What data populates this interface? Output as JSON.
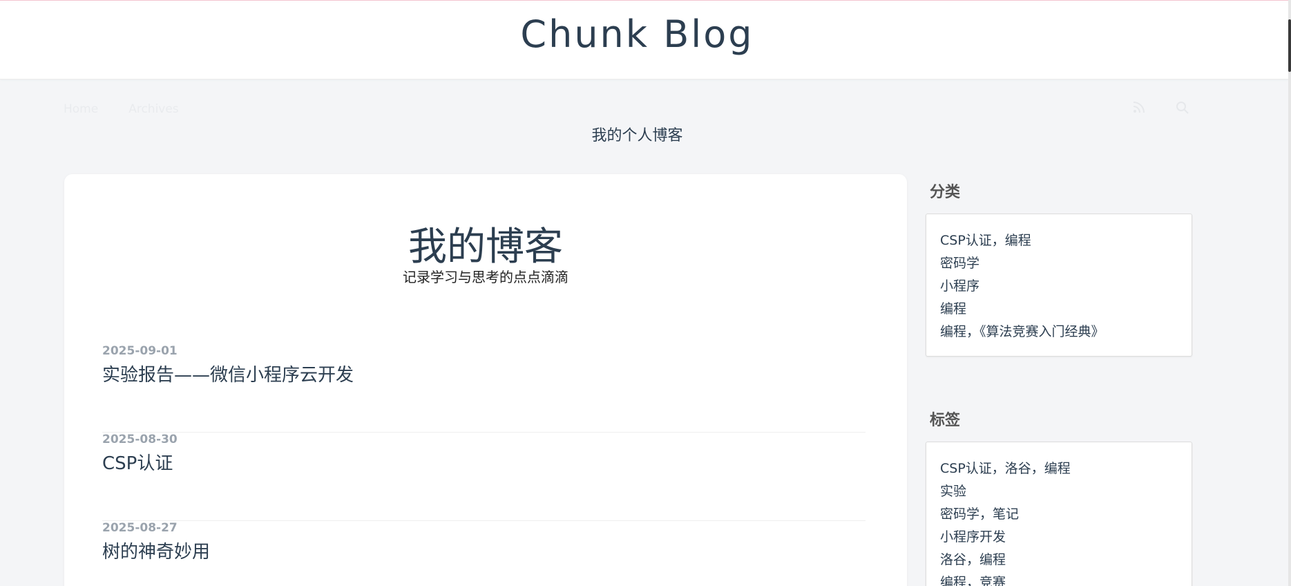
{
  "site": {
    "title": "Chunk Blog",
    "tagline": "我的个人博客"
  },
  "nav": {
    "items": [
      {
        "label": "Home"
      },
      {
        "label": "Archives"
      }
    ]
  },
  "main": {
    "title": "我的博客",
    "subtitle": "记录学习与思考的点点滴滴",
    "posts": [
      {
        "date": "2025-09-01",
        "title": "实验报告——微信小程序云开发"
      },
      {
        "date": "2025-08-30",
        "title": "CSP认证"
      },
      {
        "date": "2025-08-27",
        "title": "树的神奇妙用"
      }
    ]
  },
  "sidebar": {
    "categories": {
      "title": "分类",
      "items": [
        "CSP认证，编程",
        "密码学",
        "小程序",
        "编程",
        "编程，《算法竞赛入门经典》"
      ]
    },
    "tags": {
      "title": "标签",
      "items": [
        "CSP认证，洛谷，编程",
        "实验",
        "密码学，笔记",
        "小程序开发",
        "洛谷，编程",
        "编程，竞赛"
      ]
    }
  },
  "icons": {
    "rss": "rss-icon",
    "search": "search-icon"
  },
  "colors": {
    "text": "#2c3e50",
    "background": "#f4f5f7",
    "date": "#9aa3ad",
    "top_rule": "#f3c4cf"
  }
}
